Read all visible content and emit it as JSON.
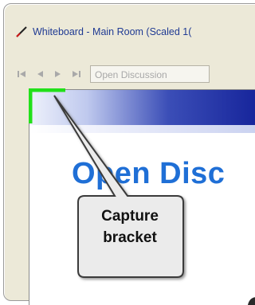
{
  "window": {
    "title": "Whiteboard - Main Room (Scaled 1(",
    "title_icon": "pen-icon"
  },
  "toolbar": {
    "buttons": [
      {
        "name": "first-page-button",
        "icon": "skip-to-start-icon"
      },
      {
        "name": "previous-page-button",
        "icon": "arrow-left-icon"
      },
      {
        "name": "next-page-button",
        "icon": "arrow-right-icon"
      },
      {
        "name": "last-page-button",
        "icon": "skip-to-end-icon"
      }
    ],
    "page_select_value": "Open Discussion"
  },
  "slide": {
    "title": "Open Disc"
  },
  "callout": {
    "line1": "Capture",
    "line2": "bracket"
  },
  "colors": {
    "bracket": "#22e01a",
    "slide_title": "#1f6fd6",
    "title_text": "#1f3a93"
  }
}
